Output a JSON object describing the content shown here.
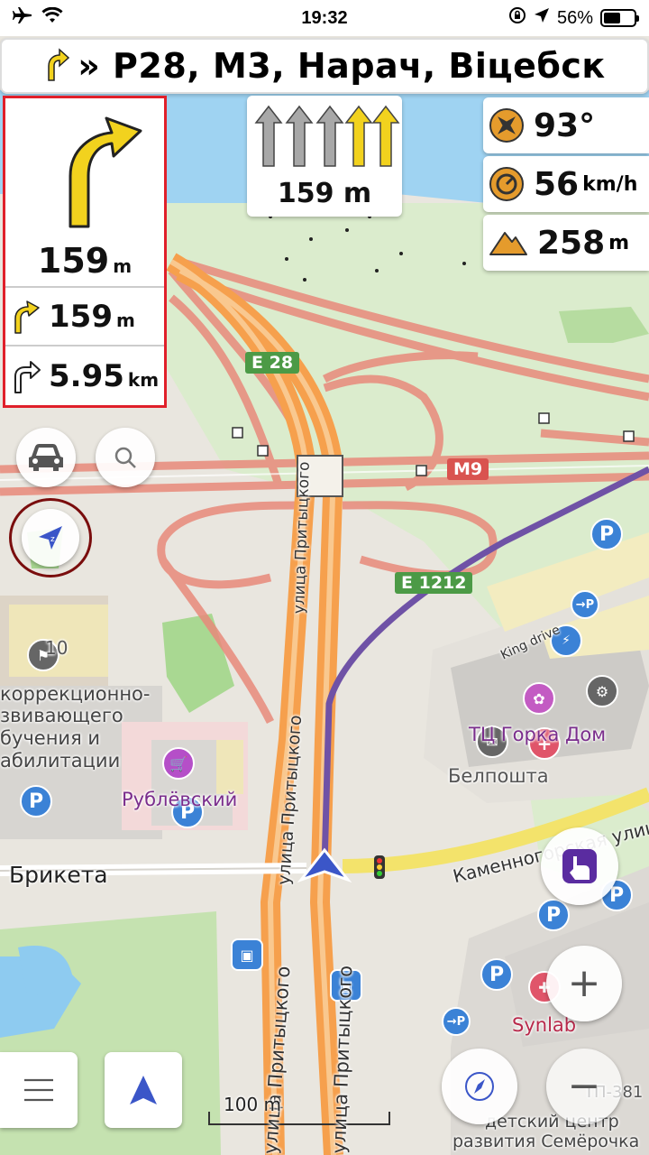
{
  "status_bar": {
    "time": "19:32",
    "battery_percent": "56%",
    "battery_level": 0.56,
    "icons": [
      "airplane-icon",
      "wifi-icon",
      "orientation-lock-icon",
      "location-arrow-icon",
      "battery-icon"
    ]
  },
  "route_banner": {
    "street": "» Р28, М3, Нарач, Віцебск",
    "icon": "turn-slight-right-icon"
  },
  "turn_panel": {
    "main_distance": "159",
    "main_unit": "m",
    "next_distance": "159",
    "next_unit": "m",
    "then_distance": "5.95",
    "then_unit": "km"
  },
  "lanes": {
    "distance": "159 m",
    "lanes": [
      "straight",
      "straight",
      "straight",
      "straight-active",
      "straight-active"
    ]
  },
  "info_widgets": {
    "bearing": "93°",
    "speed_value": "56",
    "speed_unit": "km/h",
    "altitude_value": "258",
    "altitude_unit": "m"
  },
  "map": {
    "road_shields": [
      "E 28",
      "M9",
      "E 1212"
    ],
    "labels": {
      "street_prityckogo_1": "улица Притыцкого",
      "street_prityckogo_2": "улица Притыцкого",
      "street_prityckogo_3": "улица Притыцкого",
      "street_prityckogo_4": "улица Притыцкого",
      "street_briketa": "Брикета",
      "street_kamennogorskaya": "Каменногорская улица",
      "king_drive": "King drive",
      "tc_gorka": "ТЦ Горка Дом",
      "belposhta": "Белпошта",
      "rublevsky": "Рублёвский",
      "synlab": "Synlab",
      "school_1": "коррекционно-",
      "school_2": "звивающего",
      "school_3": "бучения и",
      "school_4": "абилитации",
      "child_center_1": "детский центр",
      "child_center_2": "развития Семёрочка",
      "building_number": "10",
      "tp_label": "ТП-381"
    },
    "scale_label": "100 m"
  },
  "controls": {
    "menu": "menu-icon",
    "my_position": "navigation-arrow-icon",
    "compass": "compass-icon",
    "zoom_in": "+",
    "zoom_out": "−"
  },
  "colors": {
    "highlight_border": "#e0202a",
    "turn_arrow": "#f2d21e",
    "route_blue": "#3b56c8",
    "road_orange": "#f6a04d",
    "map_green": "#cfe6b8",
    "water": "#8ecbf0"
  }
}
